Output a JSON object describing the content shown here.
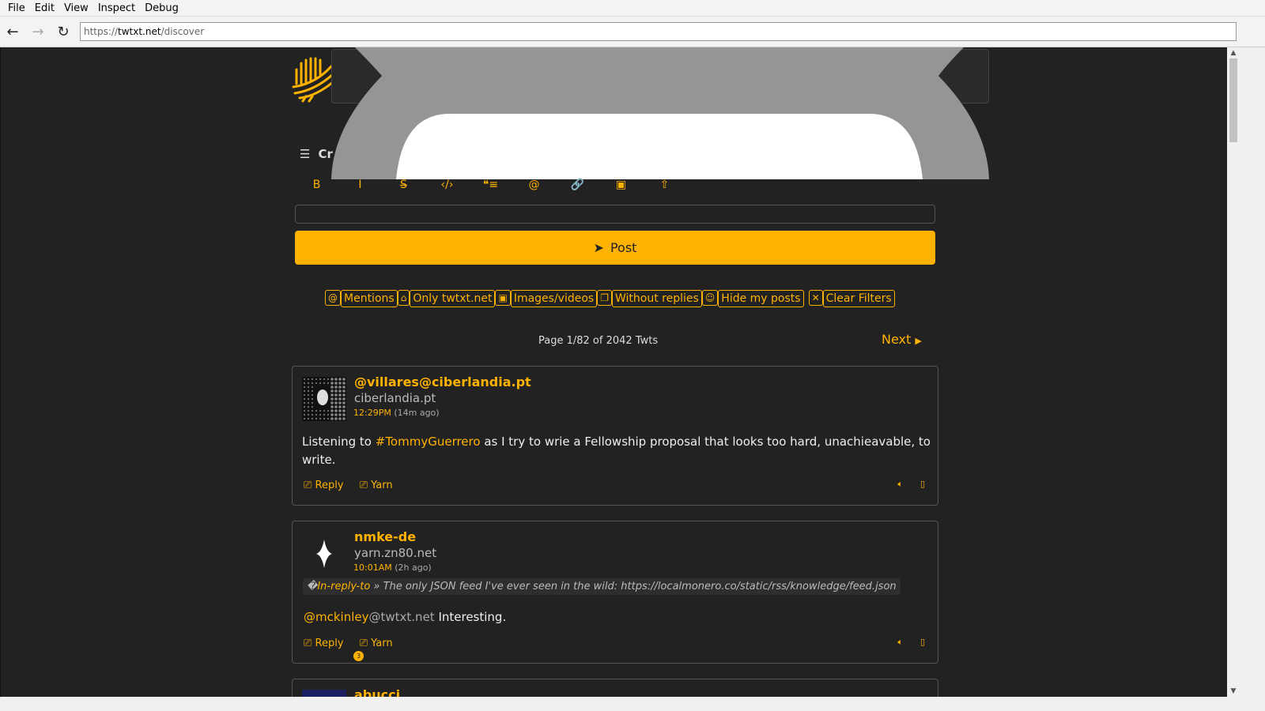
{
  "menu": [
    "File",
    "Edit",
    "View",
    "Inspect",
    "Debug"
  ],
  "url": {
    "scheme": "https://",
    "host": "twtxt.net",
    "path": "/discover"
  },
  "create_label": "Cr",
  "toolbar": [
    {
      "icon": "bold-icon",
      "g": "B"
    },
    {
      "icon": "italic-icon",
      "g": "I"
    },
    {
      "icon": "strikethrough-icon",
      "g": "S̶"
    },
    {
      "icon": "code-icon",
      "g": "‹/›"
    },
    {
      "icon": "quote-icon",
      "g": "❝≡"
    },
    {
      "icon": "mention-icon",
      "g": "@"
    },
    {
      "icon": "link-icon",
      "g": "🔗"
    },
    {
      "icon": "image-icon",
      "g": "▣"
    },
    {
      "icon": "upload-icon",
      "g": "⇧"
    }
  ],
  "post_label": "Post",
  "filters": [
    {
      "icon": "at-icon",
      "g": "@",
      "label": "Mentions"
    },
    {
      "icon": "home-icon",
      "g": "⌂",
      "label": "Only twtxt.net"
    },
    {
      "icon": "image-icon",
      "g": "▣",
      "label": "Images/videos"
    },
    {
      "icon": "comment-icon",
      "g": "❐",
      "label": "Without replies"
    },
    {
      "icon": "user-icon",
      "g": "☺",
      "label": "Hide my posts"
    },
    {
      "icon": "close-icon",
      "g": "✕",
      "label": "Clear Filters"
    }
  ],
  "pager": {
    "text": "Page 1/82 of 2042 Twts",
    "next": "Next"
  },
  "accent": "#ffb300",
  "twts": [
    {
      "user": "@villares@ciberlandia.pt",
      "host": "ciberlandia.pt",
      "time": "12:29PM",
      "ago": "(14m ago)",
      "pre": "Listening to ",
      "tag": "#TommyGuerrero",
      "post": " as I try to wrie a Fellowship proposal that looks too hard, unachieavable, to write.",
      "reply": "Reply",
      "yarn": "Yarn"
    },
    {
      "user": "nmke-de",
      "host": "yarn.zn80.net",
      "time": "10:01AM",
      "ago": "(2h ago)",
      "inreply_prefix": "�",
      "inreply": "In-reply-to",
      "inreply_text": " » The only JSON feed I've ever seen in the wild: https://localmonero.co/static/rss/knowledge/feed.json",
      "mention": "@mckinley",
      "mention_host": "@twtxt.net",
      "text": " Interesting.",
      "reply": "Reply",
      "yarn": "Yarn",
      "yarn_count": "3"
    },
    {
      "user": "abucci"
    }
  ]
}
